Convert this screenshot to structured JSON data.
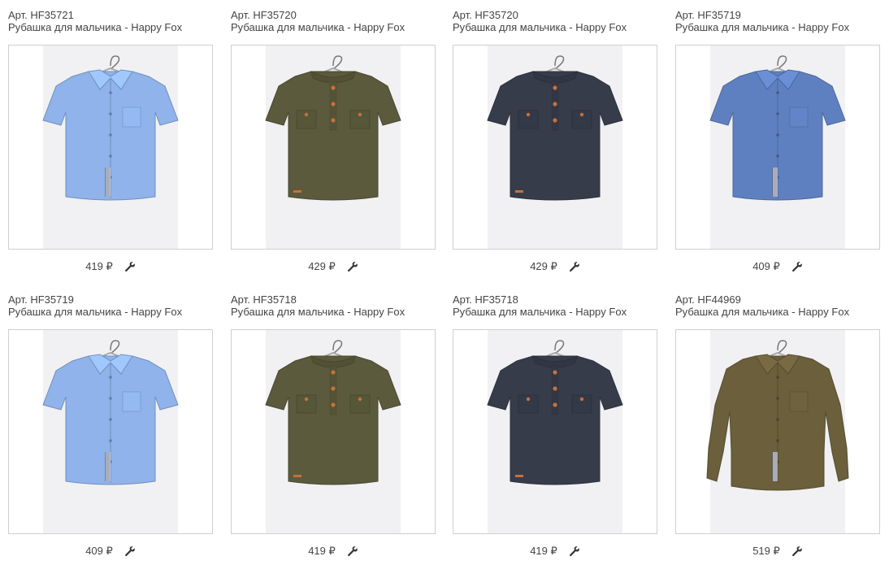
{
  "products": [
    {
      "art": "Арт. HF35721",
      "name": "Рубашка для мальчика - Happy Fox",
      "price": "419 ₽",
      "image": "light-blue-short-sleeve-shirt",
      "color": "#8fb3ea"
    },
    {
      "art": "Арт. HF35720",
      "name": "Рубашка для мальчика - Happy Fox",
      "price": "429 ₽",
      "image": "olive-short-sleeve-shirt",
      "color": "#5b5a3c"
    },
    {
      "art": "Арт. HF35720",
      "name": "Рубашка для мальчика - Happy Fox",
      "price": "429 ₽",
      "image": "navy-short-sleeve-shirt",
      "color": "#373c4b"
    },
    {
      "art": "Арт. HF35719",
      "name": "Рубашка для мальчика - Happy Fox",
      "price": "409 ₽",
      "image": "blue-short-sleeve-shirt",
      "color": "#5f80c0"
    },
    {
      "art": "Арт. HF35719",
      "name": "Рубашка для мальчика - Happy Fox",
      "price": "409 ₽",
      "image": "light-blue-short-sleeve-shirt",
      "color": "#8fb3ea"
    },
    {
      "art": "Арт. HF35718",
      "name": "Рубашка для мальчика - Happy Fox",
      "price": "419 ₽",
      "image": "olive-short-sleeve-shirt",
      "color": "#5b5a3c"
    },
    {
      "art": "Арт. HF35718",
      "name": "Рубашка для мальчика - Happy Fox",
      "price": "419 ₽",
      "image": "navy-short-sleeve-shirt",
      "color": "#373c4b"
    },
    {
      "art": "Арт. HF44969",
      "name": "Рубашка для мальчика - Happy Fox",
      "price": "519 ₽",
      "image": "olive-long-sleeve-shirt",
      "color": "#6b5f3c"
    }
  ],
  "icons": {
    "settings": "wrench-icon"
  }
}
